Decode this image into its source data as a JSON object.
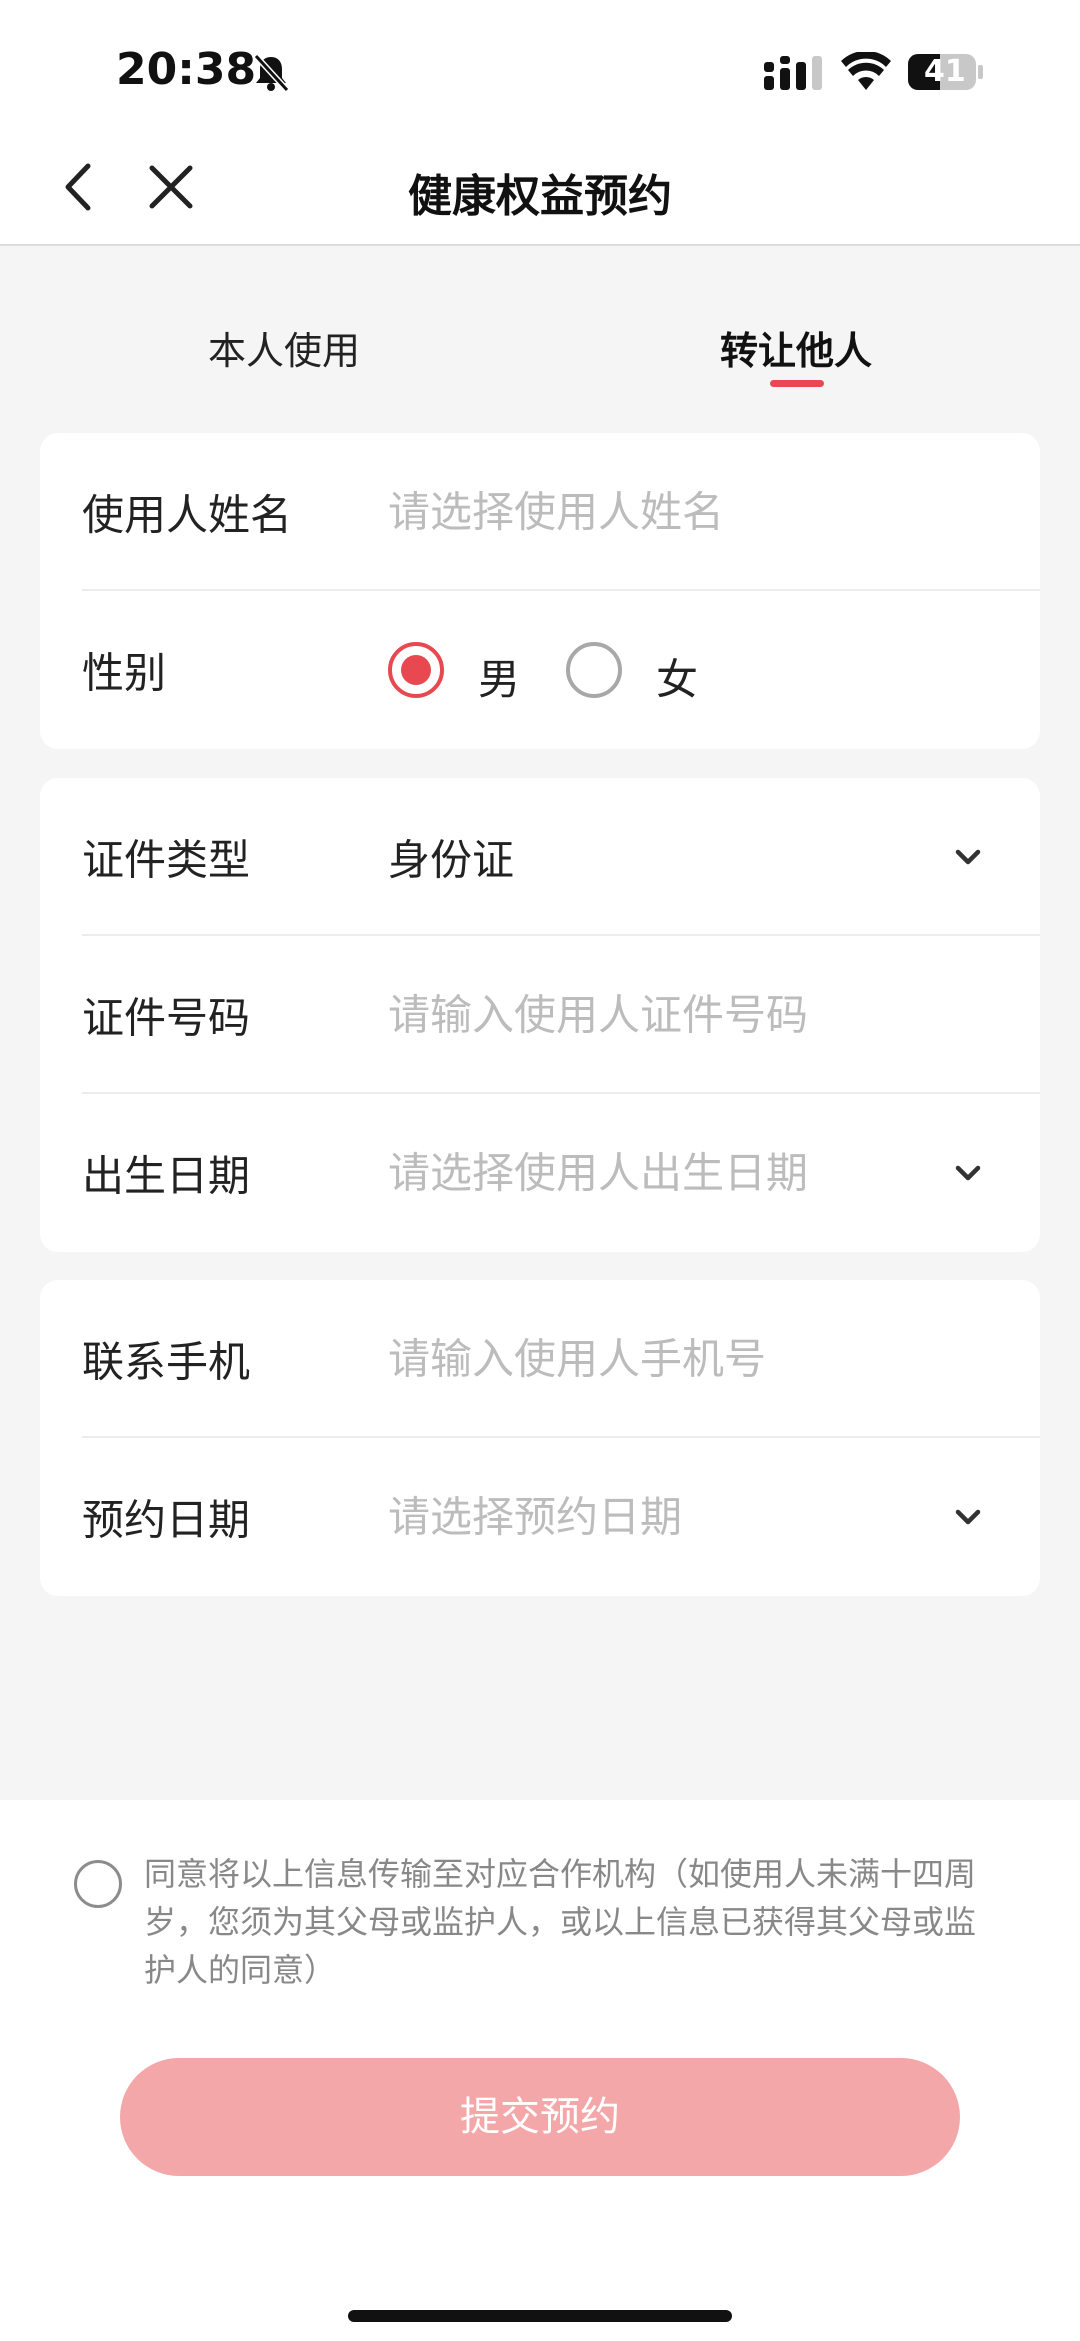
{
  "status_bar": {
    "time": "20:38",
    "battery": "41",
    "icons": [
      "bell-mute-icon",
      "signal-icon",
      "wifi-icon",
      "battery-icon"
    ]
  },
  "nav": {
    "title": "健康权益预约",
    "icons": [
      "back-icon",
      "close-icon"
    ]
  },
  "tabs": [
    {
      "label": "本人使用",
      "active": false
    },
    {
      "label": "转让他人",
      "active": true
    }
  ],
  "form": {
    "name": {
      "label": "使用人姓名",
      "placeholder": "请选择使用人姓名"
    },
    "gender": {
      "label": "性别",
      "options": [
        "男",
        "女"
      ],
      "selected": "男"
    },
    "id_type": {
      "label": "证件类型",
      "value": "身份证"
    },
    "id_number": {
      "label": "证件号码",
      "placeholder": "请输入使用人证件号码"
    },
    "birth_date": {
      "label": "出生日期",
      "placeholder": "请选择使用人出生日期"
    },
    "phone": {
      "label": "联系手机",
      "placeholder": "请输入使用人手机号"
    },
    "appointment_date": {
      "label": "预约日期",
      "placeholder": "请选择预约日期"
    }
  },
  "agreement": {
    "text": "同意将以上信息传输至对应合作机构（如使用人未满十四周岁，您须为其父母或监护人，或以上信息已获得其父母或监护人的同意）",
    "checked": false
  },
  "submit_label": "提交预约",
  "colors": {
    "accent": "#e8484f",
    "submit_disabled": "#f4a7a9",
    "background": "#f5f5f5",
    "placeholder": "#bcbcbc"
  }
}
